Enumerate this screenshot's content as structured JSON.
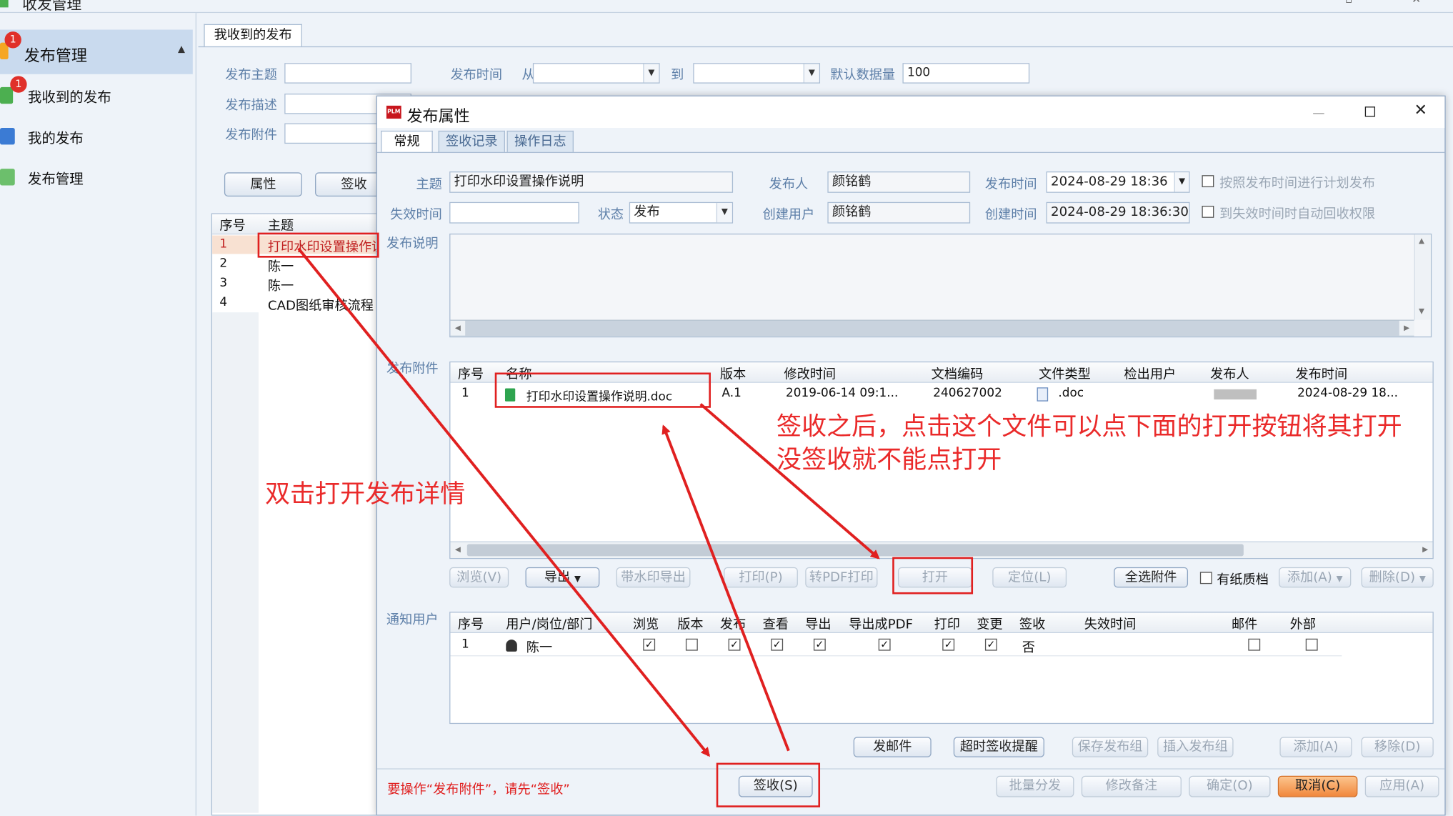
{
  "app": {
    "title": "收发管理"
  },
  "sidebar": {
    "header": "发布管理",
    "header_badge": "1",
    "items": [
      {
        "label": "我收到的发布",
        "badge": "1"
      },
      {
        "label": "我的发布"
      },
      {
        "label": "发布管理"
      }
    ]
  },
  "bg": {
    "tab": "我收到的发布",
    "filters": {
      "subject_label": "发布主题",
      "desc_label": "发布描述",
      "attach_label": "发布附件",
      "time_label": "发布时间",
      "from_label": "从",
      "to_label": "到",
      "default_count_label": "默认数据量",
      "default_count_value": "100"
    },
    "buttons": {
      "props": "属性",
      "sign": "签收"
    },
    "table": {
      "headers": [
        "序号",
        "主题"
      ],
      "rows": [
        {
          "no": "1",
          "subject": "打印水印设置操作说明"
        },
        {
          "no": "2",
          "subject": "陈一"
        },
        {
          "no": "3",
          "subject": "陈一"
        },
        {
          "no": "4",
          "subject": "CAD图纸审核流程"
        }
      ]
    }
  },
  "dialog": {
    "title": "发布属性",
    "logo_text": "PLM",
    "tabs": [
      "常规",
      "签收记录",
      "操作日志"
    ],
    "form": {
      "subject_label": "主题",
      "subject_value": "打印水印设置操作说明",
      "publisher_label": "发布人",
      "publisher_value": "颜铭鹤",
      "pubtime_label": "发布时间",
      "pubtime_value": "2024-08-29 18:36",
      "schedule_label": "按照发布时间进行计划发布",
      "expire_label": "失效时间",
      "expire_value": "",
      "status_label": "状态",
      "status_value": "发布",
      "creator_label": "创建用户",
      "creator_value": "颜铭鹤",
      "createtime_label": "创建时间",
      "createtime_value": "2024-08-29 18:36:30",
      "revoke_label": "到失效时间时自动回收权限",
      "desc_label": "发布说明",
      "attach_label": "发布附件",
      "notify_label": "通知用户"
    },
    "attach_table": {
      "headers": [
        "序号",
        "名称",
        "版本",
        "修改时间",
        "文档编码",
        "文件类型",
        "检出用户",
        "发布人",
        "发布时间"
      ],
      "rows": [
        {
          "no": "1",
          "name": "打印水印设置操作说明.doc",
          "version": "A.1",
          "modified": "2019-06-14 09:1...",
          "code": "240627002",
          "type": ".doc",
          "checkout": "",
          "publisher": "",
          "pubtime": "2024-08-29 18..."
        }
      ]
    },
    "attach_buttons": {
      "browse": "浏览(V)",
      "export": "导出",
      "wm_export": "带水印导出",
      "print": "打印(P)",
      "pdf_print": "转PDF打印",
      "open": "打开",
      "locate": "定位(L)",
      "select_all": "全选附件",
      "paper": "有纸质档",
      "add": "添加(A)",
      "delete": "删除(D)"
    },
    "notify_table": {
      "headers": [
        "序号",
        "用户/岗位/部门",
        "浏览",
        "版本",
        "发布",
        "查看",
        "导出",
        "导出成PDF",
        "打印",
        "变更",
        "签收",
        "失效时间",
        "邮件",
        "外部"
      ],
      "rows": [
        {
          "no": "1",
          "user": "陈一",
          "browse": true,
          "version": false,
          "publish": true,
          "view": true,
          "export": true,
          "export_pdf": true,
          "print": true,
          "change": true,
          "signed": "否",
          "expire": "",
          "mail": false,
          "external": false
        }
      ]
    },
    "notify_buttons": {
      "send_mail": "发邮件",
      "overdue": "超时签收提醒",
      "save_group": "保存发布组",
      "insert_group": "插入发布组",
      "add": "添加(A)",
      "remove": "移除(D)"
    },
    "footer": {
      "warning": "要操作“发布附件”，请先“签收”",
      "sign": "签收(S)",
      "batch": "批量分发",
      "edit_note": "修改备注",
      "ok": "确定(O)",
      "cancel": "取消(C)",
      "apply": "应用(A)"
    }
  },
  "annotations": {
    "dblclick": "双击打开发布详情",
    "open_line1": "签收之后，点击这个文件可以点下面的打开按钮将其打开",
    "open_line2": "没签收就不能点打开"
  },
  "colors": {
    "accent": "#e02020",
    "label": "#5d7fa8",
    "cancel": "#f1883d"
  }
}
